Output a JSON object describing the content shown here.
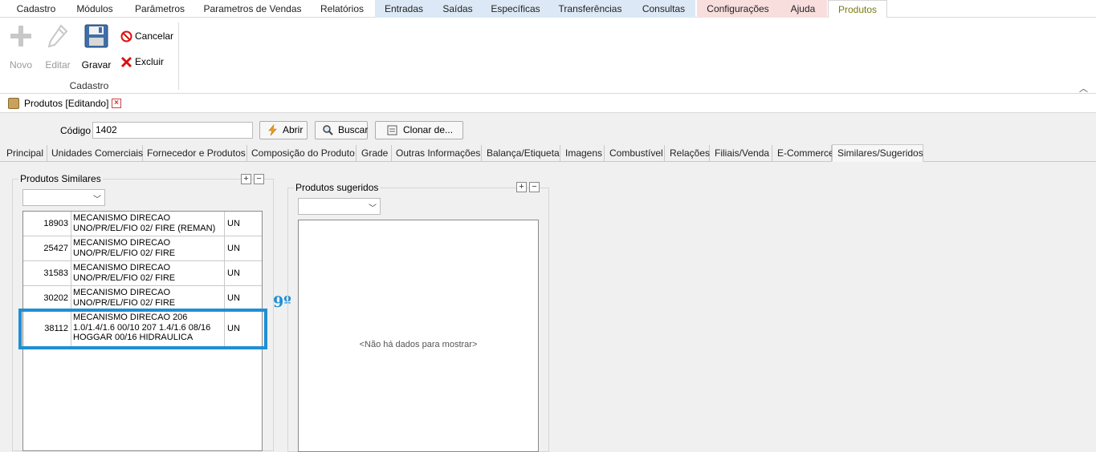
{
  "menu": {
    "items": [
      "Cadastro",
      "Módulos",
      "Parâmetros",
      "Parametros de Vendas",
      "Relatórios",
      "Entradas",
      "Saídas",
      "Específicas",
      "Transferências",
      "Consultas",
      "Configurações",
      "Ajuda",
      "Produtos"
    ]
  },
  "ribbon": {
    "novo": "Novo",
    "editar": "Editar",
    "gravar": "Gravar",
    "cancelar": "Cancelar",
    "excluir": "Excluir",
    "group": "Cadastro"
  },
  "doc_tab": {
    "title": "Produtos [Editando]"
  },
  "toolbar": {
    "codigo_label": "Código",
    "codigo_value": "1402",
    "abrir": "Abrir",
    "buscar": "Buscar",
    "clonar": "Clonar de..."
  },
  "tabs": [
    "Principal",
    "Unidades Comerciais",
    "Fornecedor e Produtos",
    "Composição do Produto",
    "Grade",
    "Outras Informações",
    "Balança/Etiqueta",
    "Imagens",
    "Combustível",
    "Relações",
    "Filiais/Venda",
    "E-Commerce",
    "Similares/Sugeridos"
  ],
  "similares": {
    "title": "Produtos Similares",
    "rows": [
      {
        "code": "18903",
        "desc": "MECANISMO DIRECAO UNO/PR/EL/FIO 02/ FIRE (REMAN)",
        "unit": "UN"
      },
      {
        "code": "25427",
        "desc": "MECANISMO DIRECAO UNO/PR/EL/FIO 02/ FIRE",
        "unit": "UN"
      },
      {
        "code": "31583",
        "desc": "MECANISMO DIRECAO UNO/PR/EL/FIO 02/ FIRE",
        "unit": "UN"
      },
      {
        "code": "30202",
        "desc": "MECANISMO DIRECAO UNO/PR/EL/FIO 02/ FIRE",
        "unit": "UN"
      },
      {
        "code": "38112",
        "desc": "MECANISMO DIRECAO 206 1.0/1.4/1.6 00/10 207 1.4/1.6 08/16 HOGGAR 00/16 HIDRAULICA",
        "unit": "UN"
      }
    ]
  },
  "sugeridos": {
    "title": "Produtos sugeridos",
    "empty": "<Não há dados para mostrar>"
  },
  "annotation": {
    "step": "9º"
  },
  "colors": {
    "highlight": "#1e8fd6",
    "active_menu": "#7a7a12"
  }
}
